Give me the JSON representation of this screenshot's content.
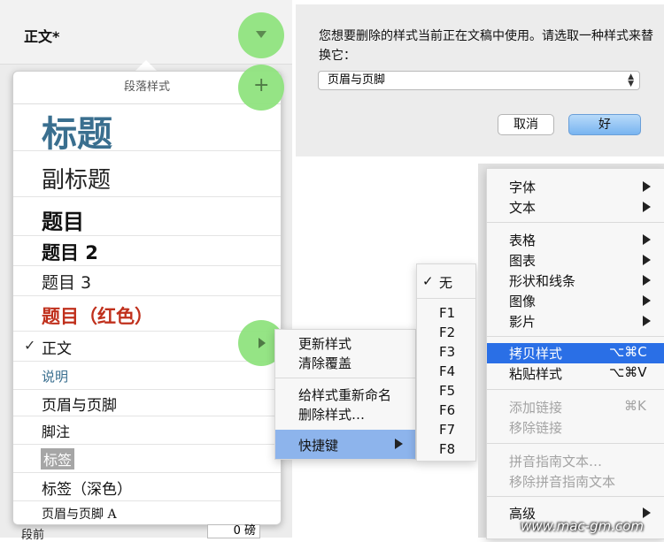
{
  "style_name": "正文*",
  "popover": {
    "header": "段落样式",
    "plus_icon": "+",
    "items": [
      {
        "label": "标题",
        "checked": false
      },
      {
        "label": "副标题",
        "checked": false
      },
      {
        "label": "题目",
        "checked": false
      },
      {
        "label": "题目 2",
        "checked": false
      },
      {
        "label": "题目 3",
        "checked": false
      },
      {
        "label": "题目（红色）",
        "checked": false
      },
      {
        "label": "正文",
        "checked": true
      },
      {
        "label": "说明",
        "checked": false
      },
      {
        "label": "页眉与页脚",
        "checked": false
      },
      {
        "label": "脚注",
        "checked": false
      },
      {
        "label": "标签",
        "checked": false
      },
      {
        "label": "标签（深色）",
        "checked": false
      },
      {
        "label": "页眉与页脚 A",
        "checked": false
      }
    ],
    "checkmark": "✓"
  },
  "bottom_field": {
    "label": "段前",
    "value": "0 磅"
  },
  "dialog": {
    "message": "您想要删除的样式当前正在文稿中使用。请选取一种样式来替换它：",
    "select_value": "页眉与页脚",
    "cancel_label": "取消",
    "ok_label": "好"
  },
  "style_menu": {
    "items": [
      "更新样式",
      "清除覆盖",
      "给样式重新命名",
      "删除样式…",
      "快捷键"
    ]
  },
  "shortcut_menu": {
    "items": [
      "无",
      "F1",
      "F2",
      "F3",
      "F4",
      "F5",
      "F6",
      "F7",
      "F8"
    ],
    "checkmark": "✓"
  },
  "format_menu": {
    "items": [
      {
        "label": "字体",
        "shortcut": "",
        "submenu": true,
        "disabled": false
      },
      {
        "label": "文本",
        "shortcut": "",
        "submenu": true,
        "disabled": false
      },
      {
        "label": "表格",
        "shortcut": "",
        "submenu": true,
        "disabled": false
      },
      {
        "label": "图表",
        "shortcut": "",
        "submenu": true,
        "disabled": false
      },
      {
        "label": "形状和线条",
        "shortcut": "",
        "submenu": true,
        "disabled": false
      },
      {
        "label": "图像",
        "shortcut": "",
        "submenu": true,
        "disabled": false
      },
      {
        "label": "影片",
        "shortcut": "",
        "submenu": true,
        "disabled": false
      },
      {
        "label": "拷贝样式",
        "shortcut": "⌥⌘C",
        "submenu": false,
        "disabled": false,
        "highlighted": true
      },
      {
        "label": "粘贴样式",
        "shortcut": "⌥⌘V",
        "submenu": false,
        "disabled": false
      },
      {
        "label": "添加链接",
        "shortcut": "⌘K",
        "submenu": false,
        "disabled": true
      },
      {
        "label": "移除链接",
        "shortcut": "",
        "submenu": false,
        "disabled": true
      },
      {
        "label": "拼音指南文本…",
        "shortcut": "",
        "submenu": false,
        "disabled": true
      },
      {
        "label": "移除拼音指南文本",
        "shortcut": "",
        "submenu": false,
        "disabled": true
      },
      {
        "label": "高级",
        "shortcut": "",
        "submenu": true,
        "disabled": false
      }
    ]
  },
  "watermark": "www.mac-gm.com",
  "colors": {
    "green_circle": "#8fe37e",
    "title_blue": "#3a6f8f",
    "red": "#c0301c",
    "highlight": "#2a6fe6",
    "ok_button": "#8fc3f5"
  }
}
